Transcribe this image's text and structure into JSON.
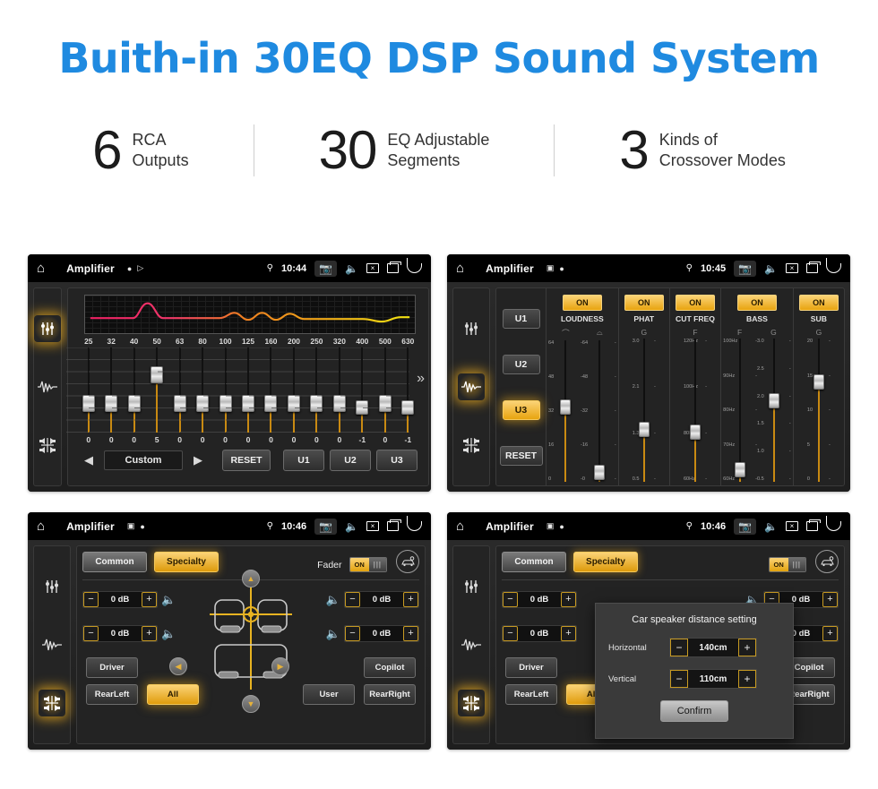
{
  "hero": {
    "title": "Buith-in 30EQ DSP Sound System"
  },
  "stats": [
    {
      "number": "6",
      "text": "RCA\nOutputs"
    },
    {
      "number": "30",
      "text": "EQ Adjustable\nSegments"
    },
    {
      "number": "3",
      "text": "Kinds of\nCrossover Modes"
    }
  ],
  "colors": {
    "title_blue": "#1f8ae0",
    "accent_amber": "#e8a40f",
    "panel_bg": "#232323"
  },
  "status_bar": {
    "app_title": "Amplifier",
    "times": {
      "p1": "10:44",
      "p2": "10:45",
      "p3": "10:46",
      "p4": "10:46"
    },
    "icons": [
      "home-icon",
      "location-pin-icon",
      "camera-icon",
      "volume-icon",
      "close-box-icon",
      "recents-icon",
      "back-icon"
    ]
  },
  "panel_eq": {
    "rail_icons": [
      "equalizer-icon",
      "waveform-icon",
      "balance-icon"
    ],
    "frequencies": [
      "25",
      "32",
      "40",
      "50",
      "63",
      "80",
      "100",
      "125",
      "160",
      "200",
      "250",
      "320",
      "400",
      "500",
      "630"
    ],
    "values": [
      "0",
      "0",
      "0",
      "5",
      "0",
      "0",
      "0",
      "0",
      "0",
      "0",
      "0",
      "0",
      "-1",
      "0",
      "-1"
    ],
    "slider_positions": [
      56,
      56,
      56,
      22,
      56,
      56,
      56,
      56,
      56,
      56,
      56,
      56,
      62,
      56,
      62
    ],
    "preset_label": "Custom",
    "prev_arrow": "◀",
    "next_arrow": "▶",
    "reset_label": "RESET",
    "user_presets": [
      "U1",
      "U2",
      "U3"
    ],
    "expand_icon": "»"
  },
  "panel_dsp": {
    "user_buttons": [
      "U1",
      "U2",
      "U3"
    ],
    "active_user": "U3",
    "reset_label": "RESET",
    "sections": [
      {
        "name": "LOUDNESS",
        "state": "ON",
        "sub_labels": [
          "curve-a",
          "curve-b"
        ],
        "sliders": [
          {
            "scale": [
              "64",
              "48",
              "32",
              "16",
              "0"
            ],
            "knob_pct": 42
          },
          {
            "scale": [
              "64",
              "48",
              "32",
              "16",
              "0"
            ],
            "knob_pct": 88
          }
        ]
      },
      {
        "name": "PHAT",
        "state": "ON",
        "sub_labels": [
          "G"
        ],
        "sliders": [
          {
            "scale": [
              "3.0",
              "2.1",
              "1.3",
              "0.5"
            ],
            "knob_pct": 58
          }
        ]
      },
      {
        "name": "CUT FREQ",
        "state": "ON",
        "sub_labels": [
          "F"
        ],
        "sliders": [
          {
            "scale": [
              "120Hz",
              "100Hz",
              "80Hz",
              "60Hz"
            ],
            "knob_pct": 60
          }
        ]
      },
      {
        "name": "BASS",
        "state": "ON",
        "sub_labels": [
          "F",
          "G"
        ],
        "sliders": [
          {
            "scale": [
              "100Hz",
              "90Hz",
              "80Hz",
              "70Hz",
              "60Hz"
            ],
            "knob_pct": 86
          },
          {
            "scale": [
              "3.0",
              "2.5",
              "2.0",
              "1.5",
              "1.0",
              "0.5"
            ],
            "knob_pct": 38
          }
        ]
      },
      {
        "name": "SUB",
        "state": "ON",
        "sub_labels": [
          "G"
        ],
        "sliders": [
          {
            "scale": [
              "20",
              "15",
              "10",
              "5",
              "0"
            ],
            "knob_pct": 25
          }
        ]
      }
    ]
  },
  "panel_balance": {
    "tabs": [
      {
        "label": "Common",
        "active": false
      },
      {
        "label": "Specialty",
        "active": true
      }
    ],
    "fader_label": "Fader",
    "fader_state": "ON",
    "car_icon": "car-settings-icon",
    "steppers": [
      {
        "position": "front-left",
        "value": "0 dB"
      },
      {
        "position": "rear-left",
        "value": "0 dB"
      },
      {
        "position": "front-right",
        "value": "0 dB"
      },
      {
        "position": "rear-right",
        "value": "0 dB"
      }
    ],
    "minus": "−",
    "plus": "+",
    "seat_buttons_left": [
      {
        "label": "Driver",
        "active": false
      },
      {
        "label": "RearLeft",
        "active": false
      }
    ],
    "seat_buttons_mid": [
      {
        "label": "All",
        "active": true
      },
      {
        "label": "User",
        "active": false
      }
    ],
    "seat_buttons_right": [
      {
        "label": "Copilot",
        "active": false
      },
      {
        "label": "RearRight",
        "active": false
      }
    ],
    "nav_arrows": [
      "up",
      "left",
      "right",
      "down"
    ]
  },
  "dialog": {
    "title": "Car speaker distance setting",
    "rows": [
      {
        "label": "Horizontal",
        "value": "140cm"
      },
      {
        "label": "Vertical",
        "value": "110cm"
      }
    ],
    "minus": "−",
    "plus": "+",
    "confirm_label": "Confirm"
  }
}
